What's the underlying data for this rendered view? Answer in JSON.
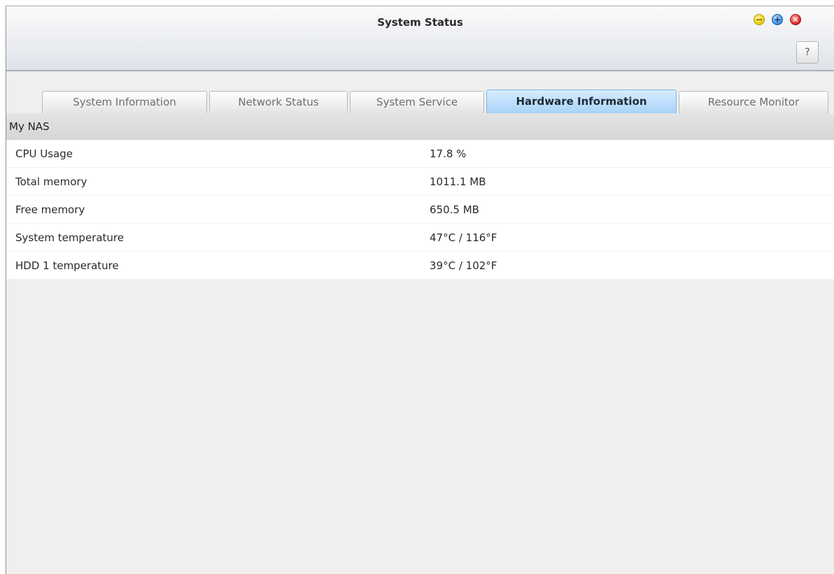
{
  "window": {
    "title": "System Status",
    "controls": {
      "minimize": "minimize-icon",
      "maximize": "maximize-icon",
      "close": "close-icon"
    },
    "help_label": "?"
  },
  "tabs": [
    {
      "label": "System Information",
      "active": false
    },
    {
      "label": "Network Status",
      "active": false
    },
    {
      "label": "System Service",
      "active": false
    },
    {
      "label": "Hardware Information",
      "active": true
    },
    {
      "label": "Resource Monitor",
      "active": false
    }
  ],
  "section": {
    "title": "My NAS"
  },
  "rows": [
    {
      "label": "CPU Usage",
      "value": "17.8 %"
    },
    {
      "label": "Total memory",
      "value": "1011.1 MB"
    },
    {
      "label": "Free memory",
      "value": "650.5 MB"
    },
    {
      "label": "System temperature",
      "value": "47°C / 116°F"
    },
    {
      "label": "HDD 1 temperature",
      "value": "39°C / 102°F"
    }
  ],
  "colors": {
    "active_tab": "#a9d3f7",
    "minimize_button": "#e6c800",
    "maximize_button": "#2f86e0",
    "close_button": "#d52121"
  }
}
